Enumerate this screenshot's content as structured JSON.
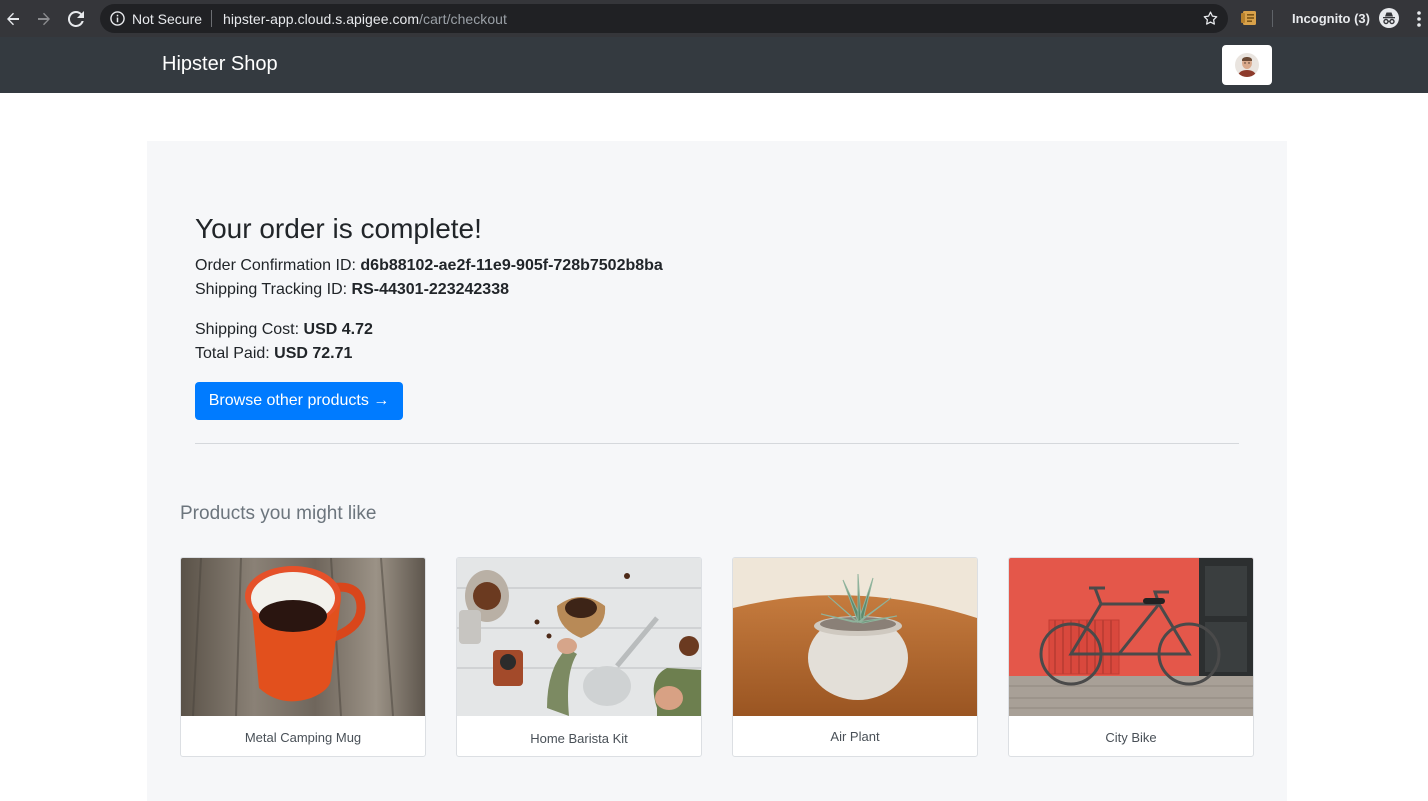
{
  "browser": {
    "secure_label": "Not Secure",
    "url_host": "hipster-app.cloud.s.apigee.com",
    "url_path": "/cart/checkout",
    "incognito_label": "Incognito (3)"
  },
  "header": {
    "brand": "Hipster Shop"
  },
  "order": {
    "title": "Your order is complete!",
    "confirmation_label": "Order Confirmation ID: ",
    "confirmation_id": "d6b88102-ae2f-11e9-905f-728b7502b8ba",
    "tracking_label": "Shipping Tracking ID: ",
    "tracking_id": "RS-44301-223242338",
    "shipping_label": "Shipping Cost: ",
    "shipping_value": "USD 4.72",
    "total_label": "Total Paid: ",
    "total_value": "USD 72.71",
    "browse_button": "Browse other products →"
  },
  "recommendations": {
    "title": "Products you might like",
    "items": [
      {
        "name": "Metal Camping Mug"
      },
      {
        "name": "Home Barista Kit"
      },
      {
        "name": "Air Plant"
      },
      {
        "name": "City Bike"
      }
    ]
  },
  "colors": {
    "header_bg": "#343a40",
    "primary": "#007bff",
    "panel_bg": "#f6f7f9"
  }
}
